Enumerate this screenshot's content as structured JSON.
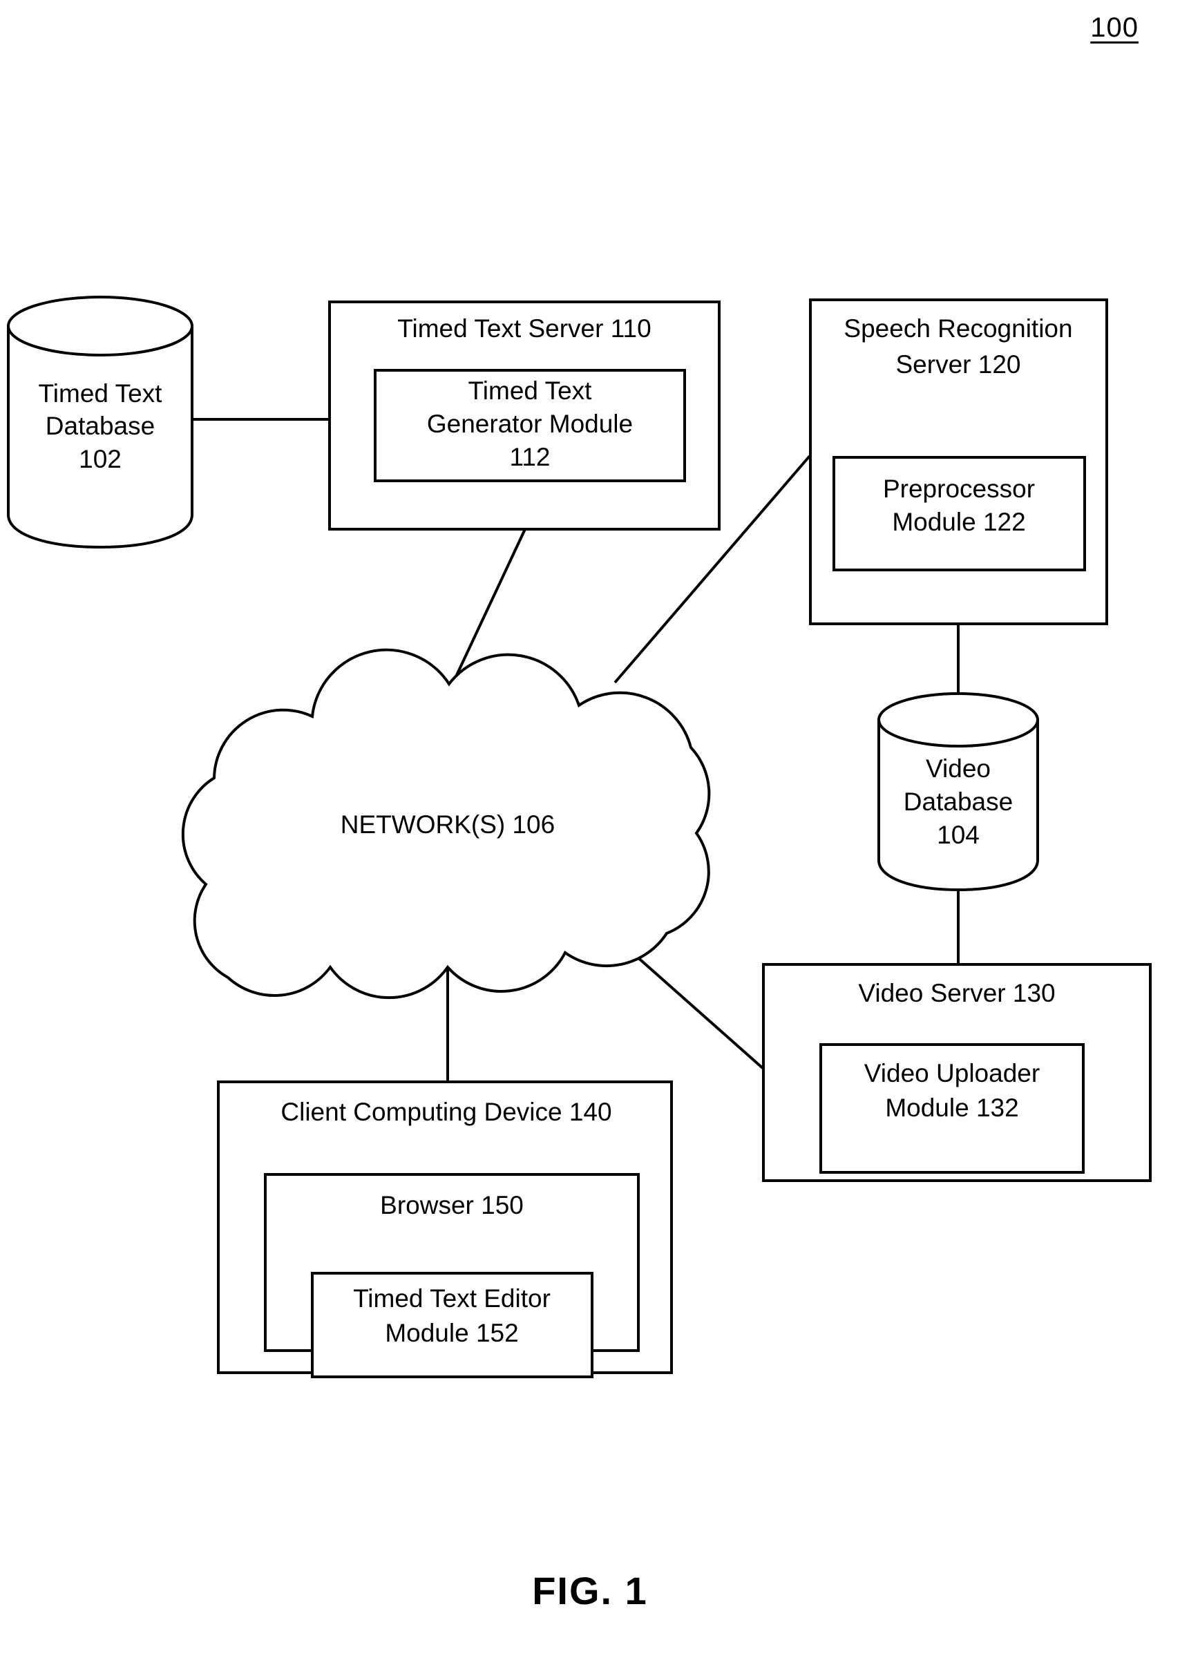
{
  "figure": {
    "reference_numeral": "100",
    "caption": "FIG. 1"
  },
  "nodes": {
    "timed_text_database": {
      "name": "Timed Text Database",
      "line1": "Timed Text",
      "line2": "Database",
      "line3": "102",
      "shape": "cylinder"
    },
    "timed_text_server": {
      "name": "Timed Text Server",
      "title": "Timed Text Server 110",
      "shape": "rectangle",
      "inner_module": {
        "name": "Timed Text Generator Module",
        "line1": "Timed Text",
        "line2": "Generator Module",
        "line3": "112",
        "shape": "rectangle"
      }
    },
    "speech_recognition_server": {
      "name": "Speech Recognition Server",
      "title_line1": "Speech Recognition",
      "title_line2": "Server 120",
      "shape": "rectangle",
      "inner_module": {
        "name": "Preprocessor Module",
        "line1": "Preprocessor",
        "line2": "Module 122",
        "shape": "rectangle"
      }
    },
    "network": {
      "name": "Networks cloud",
      "label": "NETWORK(S) 106",
      "shape": "cloud"
    },
    "video_database": {
      "name": "Video Database",
      "line1": "Video",
      "line2": "Database",
      "line3": "104",
      "shape": "cylinder"
    },
    "video_server": {
      "name": "Video Server",
      "title": "Video Server 130",
      "shape": "rectangle",
      "inner_module": {
        "name": "Video Uploader Module",
        "line1": "Video Uploader",
        "line2": "Module 132",
        "shape": "rectangle"
      }
    },
    "client_computing_device": {
      "name": "Client Computing Device",
      "title": "Client Computing Device 140",
      "shape": "rectangle",
      "browser": {
        "name": "Browser",
        "title": "Browser 150",
        "shape": "rectangle",
        "inner_module": {
          "name": "Timed Text Editor Module",
          "line1": "Timed Text Editor",
          "line2": "Module 152",
          "shape": "rectangle"
        }
      }
    }
  },
  "connections": [
    {
      "from": "timed_text_database",
      "to": "timed_text_server",
      "style": "straight-horizontal"
    },
    {
      "from": "timed_text_server",
      "to": "network",
      "style": "diagonal"
    },
    {
      "from": "speech_recognition_server",
      "to": "network",
      "style": "diagonal"
    },
    {
      "from": "speech_recognition_server",
      "to": "video_database",
      "style": "straight-vertical"
    },
    {
      "from": "video_database",
      "to": "video_server",
      "style": "straight-vertical"
    },
    {
      "from": "network",
      "to": "video_server",
      "style": "diagonal"
    },
    {
      "from": "network",
      "to": "client_computing_device",
      "style": "straight-vertical"
    }
  ],
  "style": {
    "line_color": "#000000",
    "background_color": "#ffffff",
    "text_color": "#000000"
  }
}
